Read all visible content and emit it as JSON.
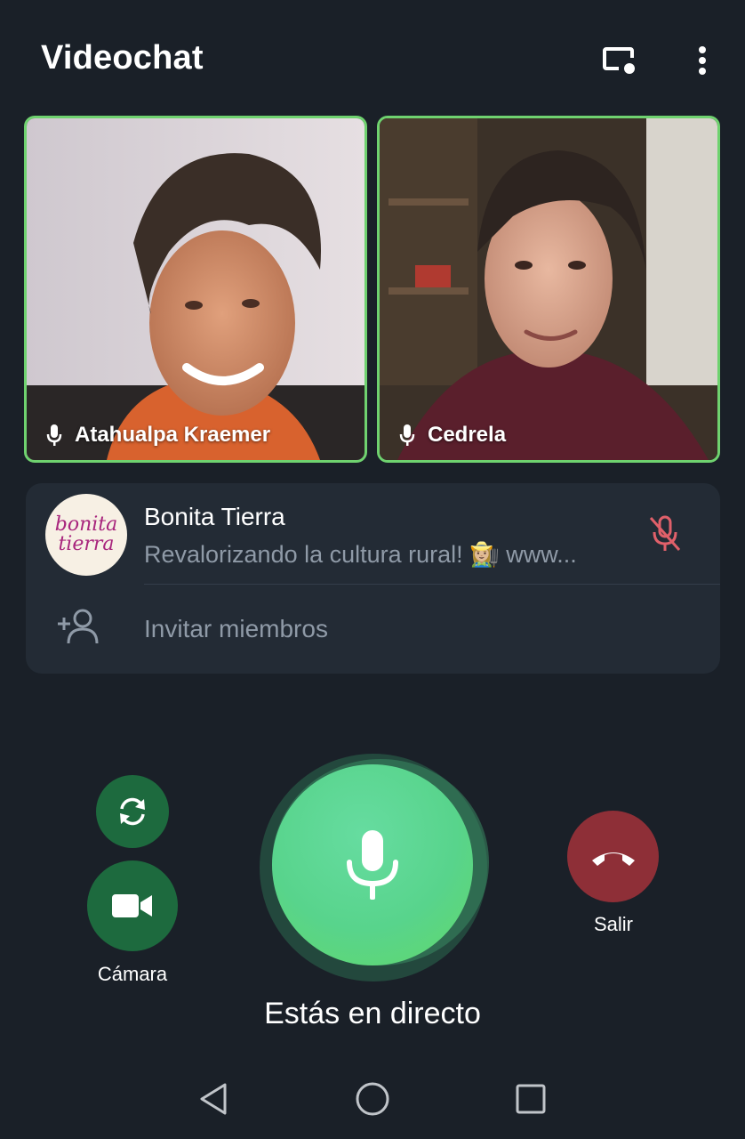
{
  "header": {
    "title": "Videochat",
    "screencast_icon": "screencast-icon",
    "more_icon": "more-vertical-icon"
  },
  "participants": [
    {
      "name": "Atahualpa Kraemer",
      "mic_icon": "microphone-icon",
      "speaking": true
    },
    {
      "name": "Cedrela",
      "mic_icon": "microphone-icon",
      "speaking": true
    }
  ],
  "group": {
    "avatar_line1": "bonita",
    "avatar_line2": "tierra",
    "name": "Bonita Tierra",
    "description": "Revalorizando la cultura rural! 👩🏼‍🌾 www...",
    "mic_status_icon": "microphone-off-icon"
  },
  "invite": {
    "label": "Invitar miembros",
    "icon": "add-user-icon"
  },
  "controls": {
    "flip_camera_icon": "camera-switch-icon",
    "camera_label": "Cámara",
    "camera_icon": "video-camera-icon",
    "mic_icon": "microphone-icon",
    "leave_label": "Salir",
    "leave_icon": "phone-hangup-icon",
    "status": "Estás en directo"
  },
  "navbar": {
    "back": "back-triangle-icon",
    "home": "home-circle-icon",
    "recents": "recents-square-icon"
  },
  "colors": {
    "background": "#1a2028",
    "card": "#232b35",
    "speaking_border": "#6fd26f",
    "mic_button": "#58d48c",
    "camera_button": "#1d6a3e",
    "leave_button": "#8e2f37",
    "muted_icon": "#e0606a"
  }
}
